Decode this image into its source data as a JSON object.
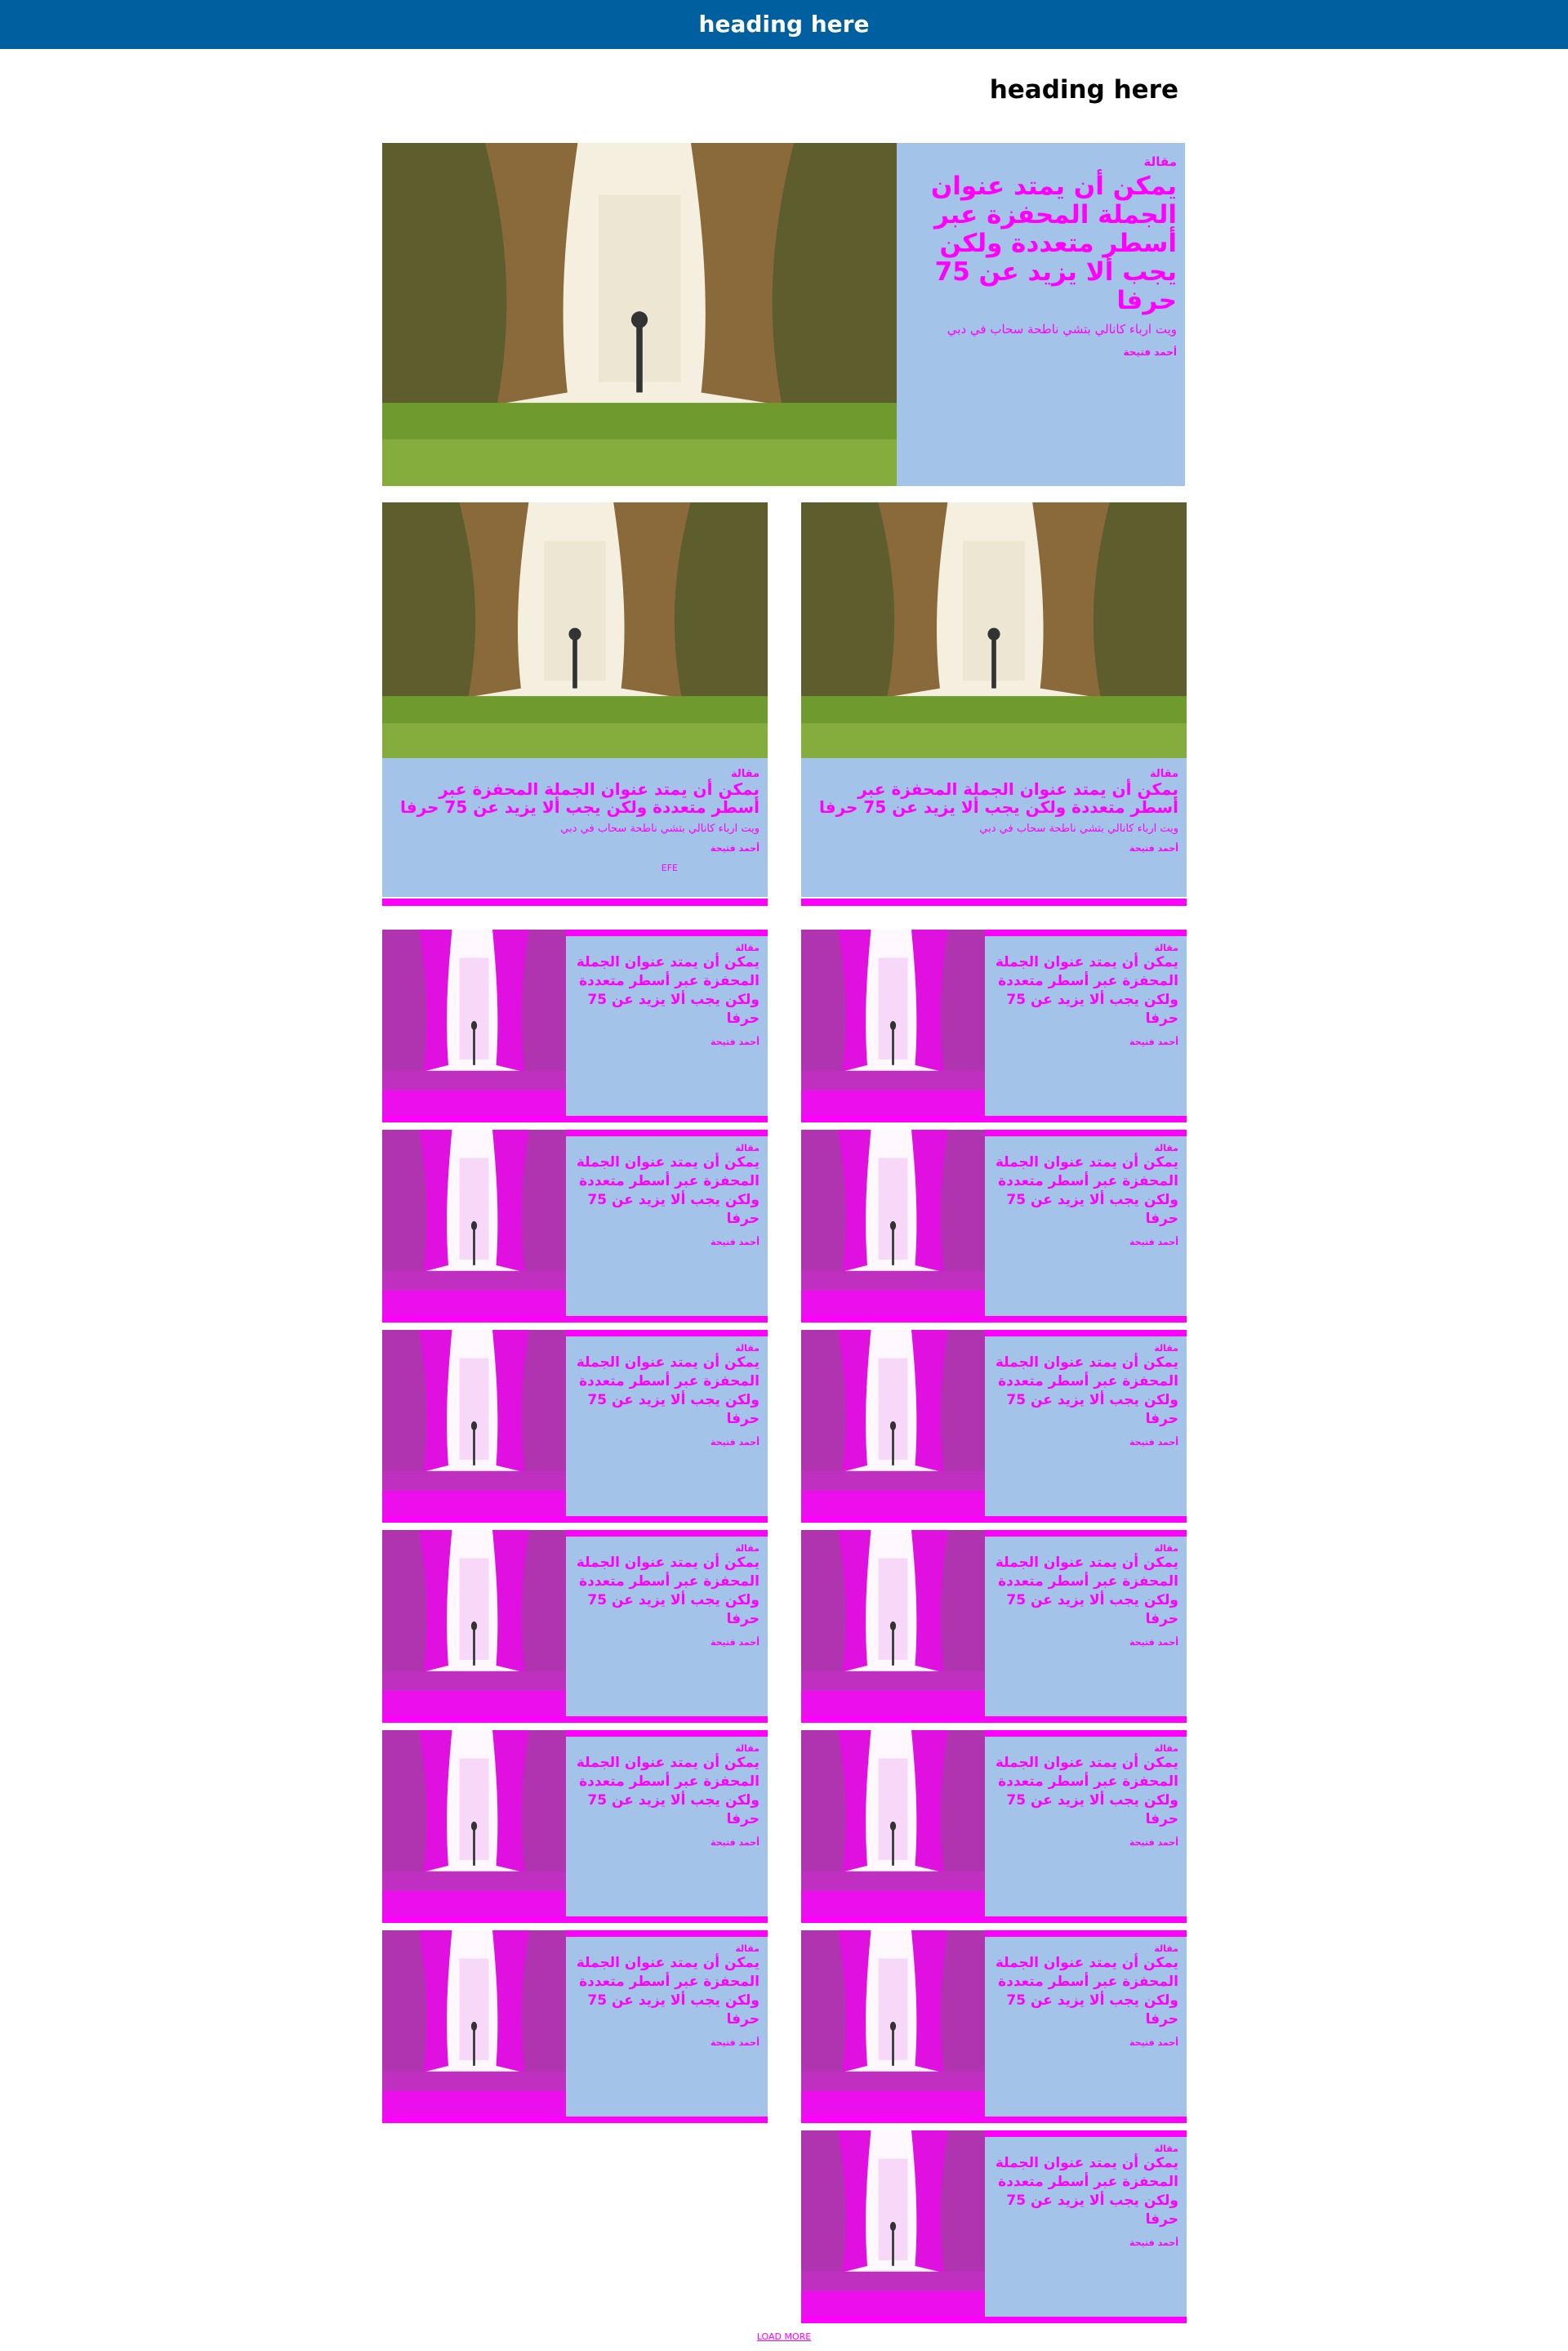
{
  "header": {
    "title": "heading here"
  },
  "section": {
    "title": "heading here"
  },
  "article": {
    "kicker": "مقالة",
    "title": "يمكن أن يمتد عنوان الجملة المحفزة عبر أسطر متعددة ولكن يجب ألا يزيد عن 75 حرفا",
    "subtitle": "ويت ارباء كانالي بتشي ناطحة سحاب في دبي",
    "author": "أحمد فتيحة",
    "source": "EFE"
  },
  "load_more": {
    "label": "LOAD MORE"
  },
  "colors": {
    "header_bg": "#005f9e",
    "card_text_bg": "#a3c4e8",
    "accent": "#ff00ff"
  }
}
